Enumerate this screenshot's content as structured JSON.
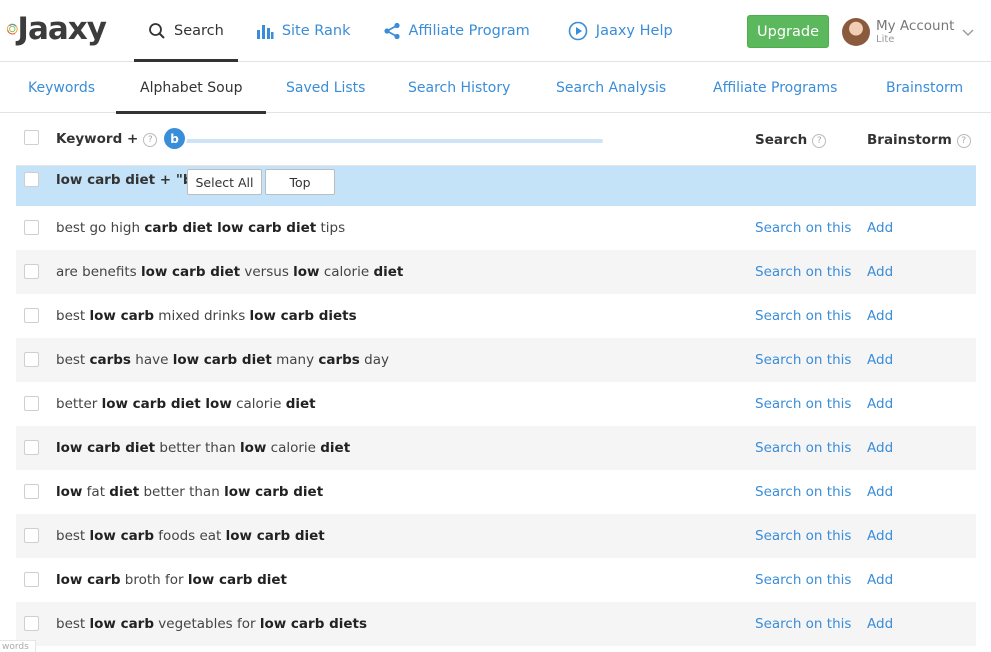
{
  "brand": {
    "logo_text": "Jaaxy",
    "colors": {
      "accent": "#3a8dd8",
      "upgrade": "#5cb85c",
      "selected_row": "#c4e2f8"
    }
  },
  "topnav": [
    {
      "label": "Search",
      "icon": "search-icon",
      "active": true
    },
    {
      "label": "Site Rank",
      "icon": "bar-chart-icon",
      "active": false
    },
    {
      "label": "Affiliate Program",
      "icon": "share-icon",
      "active": false
    },
    {
      "label": "Jaaxy Help",
      "icon": "play-circle-icon",
      "active": false
    }
  ],
  "upgrade_label": "Upgrade",
  "account": {
    "name": "My Account",
    "plan": "Lite"
  },
  "subtabs": [
    {
      "label": "Keywords",
      "active": false
    },
    {
      "label": "Alphabet Soup",
      "active": true
    },
    {
      "label": "Saved Lists",
      "active": false
    },
    {
      "label": "Search History",
      "active": false
    },
    {
      "label": "Search Analysis",
      "active": false
    },
    {
      "label": "Affiliate Programs",
      "active": false
    },
    {
      "label": "Brainstorm",
      "active": false
    }
  ],
  "table": {
    "col_keyword": "Keyword +",
    "col_search": "Search",
    "col_brainstorm": "Brainstorm",
    "slider_letter": "b",
    "help_mark": "?",
    "group": {
      "label": "low carb diet + \"b\"",
      "select_all": "Select All",
      "top": "Top"
    },
    "search_link": "Search on this",
    "add_link": "Add",
    "rows": [
      [
        [
          "best go high ",
          false
        ],
        [
          "carb diet low carb diet",
          true
        ],
        [
          " tips",
          false
        ]
      ],
      [
        [
          "are benefits ",
          false
        ],
        [
          "low carb diet",
          true
        ],
        [
          " versus ",
          false
        ],
        [
          "low",
          true
        ],
        [
          " calorie ",
          false
        ],
        [
          "diet",
          true
        ]
      ],
      [
        [
          "best ",
          false
        ],
        [
          "low carb",
          true
        ],
        [
          " mixed drinks ",
          false
        ],
        [
          "low carb diets",
          true
        ]
      ],
      [
        [
          "best ",
          false
        ],
        [
          "carbs",
          true
        ],
        [
          " have ",
          false
        ],
        [
          "low carb diet",
          true
        ],
        [
          " many ",
          false
        ],
        [
          "carbs",
          true
        ],
        [
          " day",
          false
        ]
      ],
      [
        [
          "better ",
          false
        ],
        [
          "low carb diet low",
          true
        ],
        [
          " calorie ",
          false
        ],
        [
          "diet",
          true
        ]
      ],
      [
        [
          "low carb diet",
          true
        ],
        [
          " better than ",
          false
        ],
        [
          "low",
          true
        ],
        [
          " calorie ",
          false
        ],
        [
          "diet",
          true
        ]
      ],
      [
        [
          "low",
          true
        ],
        [
          " fat ",
          false
        ],
        [
          "diet",
          true
        ],
        [
          " better than ",
          false
        ],
        [
          "low carb diet",
          true
        ]
      ],
      [
        [
          "best ",
          false
        ],
        [
          "low carb",
          true
        ],
        [
          " foods eat ",
          false
        ],
        [
          "low carb diet",
          true
        ]
      ],
      [
        [
          "low carb",
          true
        ],
        [
          " broth for ",
          false
        ],
        [
          "low carb diet",
          true
        ]
      ],
      [
        [
          "best ",
          false
        ],
        [
          "low carb",
          true
        ],
        [
          " vegetables for ",
          false
        ],
        [
          "low carb diets",
          true
        ]
      ]
    ]
  },
  "footer_tag": "words"
}
